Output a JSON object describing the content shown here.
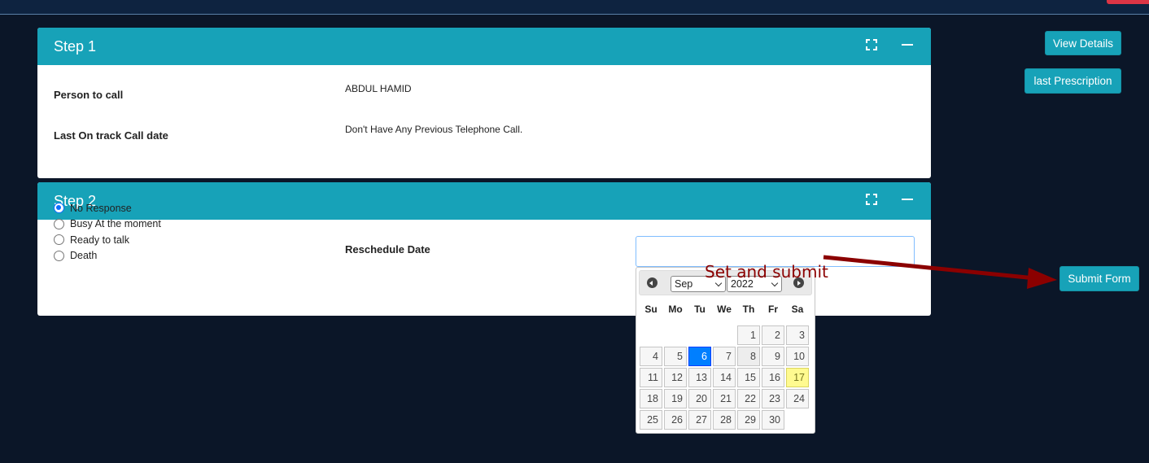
{
  "step1": {
    "title": "Step 1",
    "person_label": "Person to call",
    "person_value": "ABDUL HAMID",
    "last_call_label": "Last On track Call date",
    "last_call_value": "Don't Have Any Previous Telephone Call."
  },
  "step2": {
    "title": "Step 2",
    "options": [
      "No Response",
      "Busy At the moment",
      "Ready to talk",
      "Death"
    ],
    "selected_option": "No Response",
    "reschedule_label": "Reschedule Date",
    "reschedule_value": ""
  },
  "buttons": {
    "view_details": "View Details",
    "last_prescription": "last Prescription",
    "submit_form": "Submit Form"
  },
  "datepicker": {
    "month": "Sep",
    "year": "2022",
    "weekdays": [
      "Su",
      "Mo",
      "Tu",
      "We",
      "Th",
      "Fr",
      "Sa"
    ],
    "first_weekday_index": 4,
    "days_in_month": 30,
    "selected_day": 6,
    "today_day": 17,
    "hover_day": 8
  },
  "annotation": {
    "text": "Set and submit",
    "color": "#8b0000"
  },
  "colors": {
    "accent": "#17a2b8",
    "background": "#0b1628",
    "selected_day": "#007fff",
    "today_day": "#fffa90"
  }
}
